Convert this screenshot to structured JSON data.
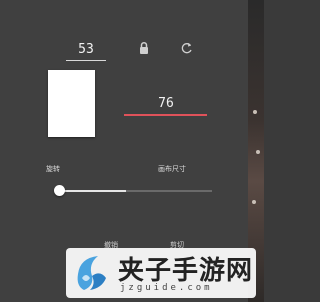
{
  "dimensions": {
    "width_value": "53",
    "height_value": "76"
  },
  "labels": {
    "left": "旋转",
    "right": "画布尺寸"
  },
  "slider": {
    "level_fraction": 0.44
  },
  "bottom_buttons": {
    "left": "撤销",
    "right": "剪切"
  },
  "icons": {
    "lock": "lock-icon",
    "rotate": "rotate-icon"
  },
  "colors": {
    "accent": "#e0525a",
    "background": "#404040",
    "preview": "#ffffff"
  },
  "watermark": {
    "title": "夹子手游网",
    "url": "jzguide.com"
  }
}
